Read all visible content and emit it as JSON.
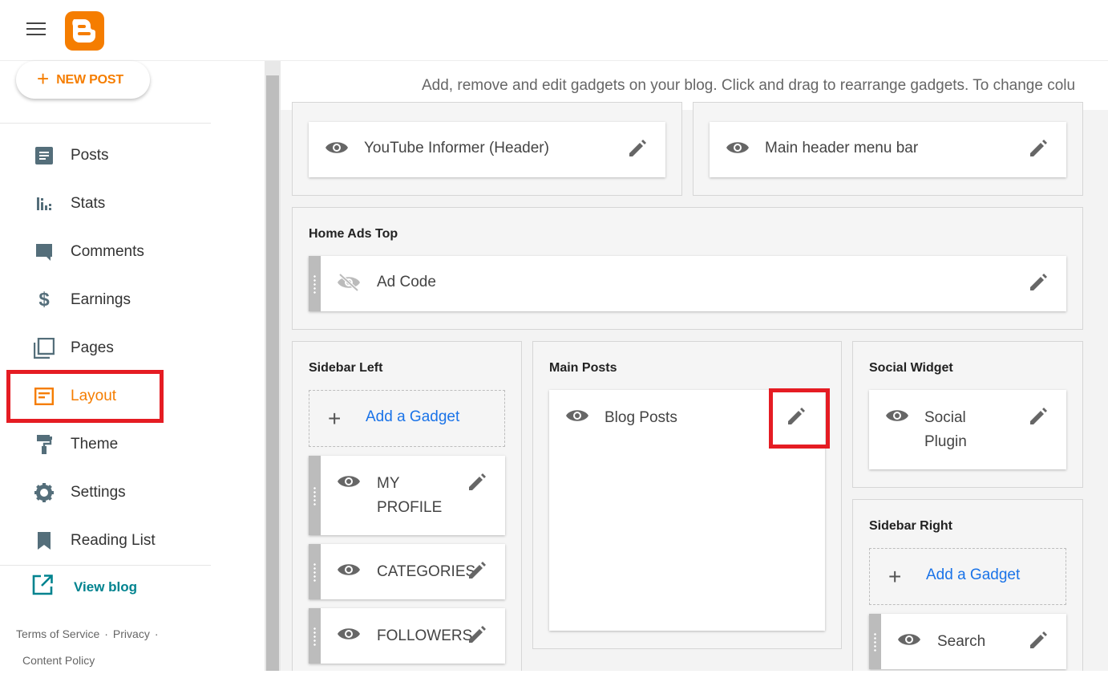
{
  "app": {
    "logo_icon": "blogger-logo-icon",
    "brand_color": "#f57d00"
  },
  "sidebar": {
    "new_post_label": "NEW POST",
    "items": [
      {
        "label": "Posts",
        "icon": "posts-icon"
      },
      {
        "label": "Stats",
        "icon": "stats-icon"
      },
      {
        "label": "Comments",
        "icon": "comments-icon"
      },
      {
        "label": "Earnings",
        "icon": "dollar-icon"
      },
      {
        "label": "Pages",
        "icon": "pages-icon"
      },
      {
        "label": "Layout",
        "icon": "layout-icon",
        "active": true
      },
      {
        "label": "Theme",
        "icon": "paint-roller-icon"
      },
      {
        "label": "Settings",
        "icon": "gear-icon"
      },
      {
        "label": "Reading List",
        "icon": "bookmark-icon"
      }
    ],
    "view_blog_label": "View blog",
    "footer": {
      "terms": "Terms of Service",
      "privacy": "Privacy",
      "content_policy": "Content Policy",
      "separator": "·"
    }
  },
  "main": {
    "hint": "Add, remove and edit gadgets on your blog. Click and drag to rearrange gadgets. To change colu",
    "header_gadgets": [
      {
        "name": "YouTube Informer (Header)",
        "visible": true
      },
      {
        "name": "Main header menu bar",
        "visible": true
      }
    ],
    "home_ads_top": {
      "title": "Home Ads Top",
      "gadgets": [
        {
          "name": "Ad Code",
          "visible": false
        }
      ]
    },
    "sidebar_left": {
      "title": "Sidebar Left",
      "add_label": "Add a Gadget",
      "gadgets": [
        {
          "name": "MY PROFILE",
          "line1": "MY",
          "line2": "PROFILE",
          "visible": true
        },
        {
          "name": "CATEGORIES",
          "visible": true
        },
        {
          "name": "FOLLOWERS",
          "visible": true
        }
      ]
    },
    "main_posts": {
      "title": "Main Posts",
      "gadgets": [
        {
          "name": "Blog Posts",
          "visible": true
        }
      ]
    },
    "social_widget": {
      "title": "Social Widget",
      "gadgets": [
        {
          "name": "Social Plugin",
          "line1": "Social",
          "line2": "Plugin",
          "visible": true
        }
      ]
    },
    "sidebar_right": {
      "title": "Sidebar Right",
      "add_label": "Add a Gadget",
      "gadgets": [
        {
          "name": "Search",
          "visible": true
        }
      ]
    }
  },
  "colors": {
    "accent": "#f57d00",
    "link": "#1a73e8",
    "highlight": "#e51c23",
    "teal": "#00838f"
  }
}
